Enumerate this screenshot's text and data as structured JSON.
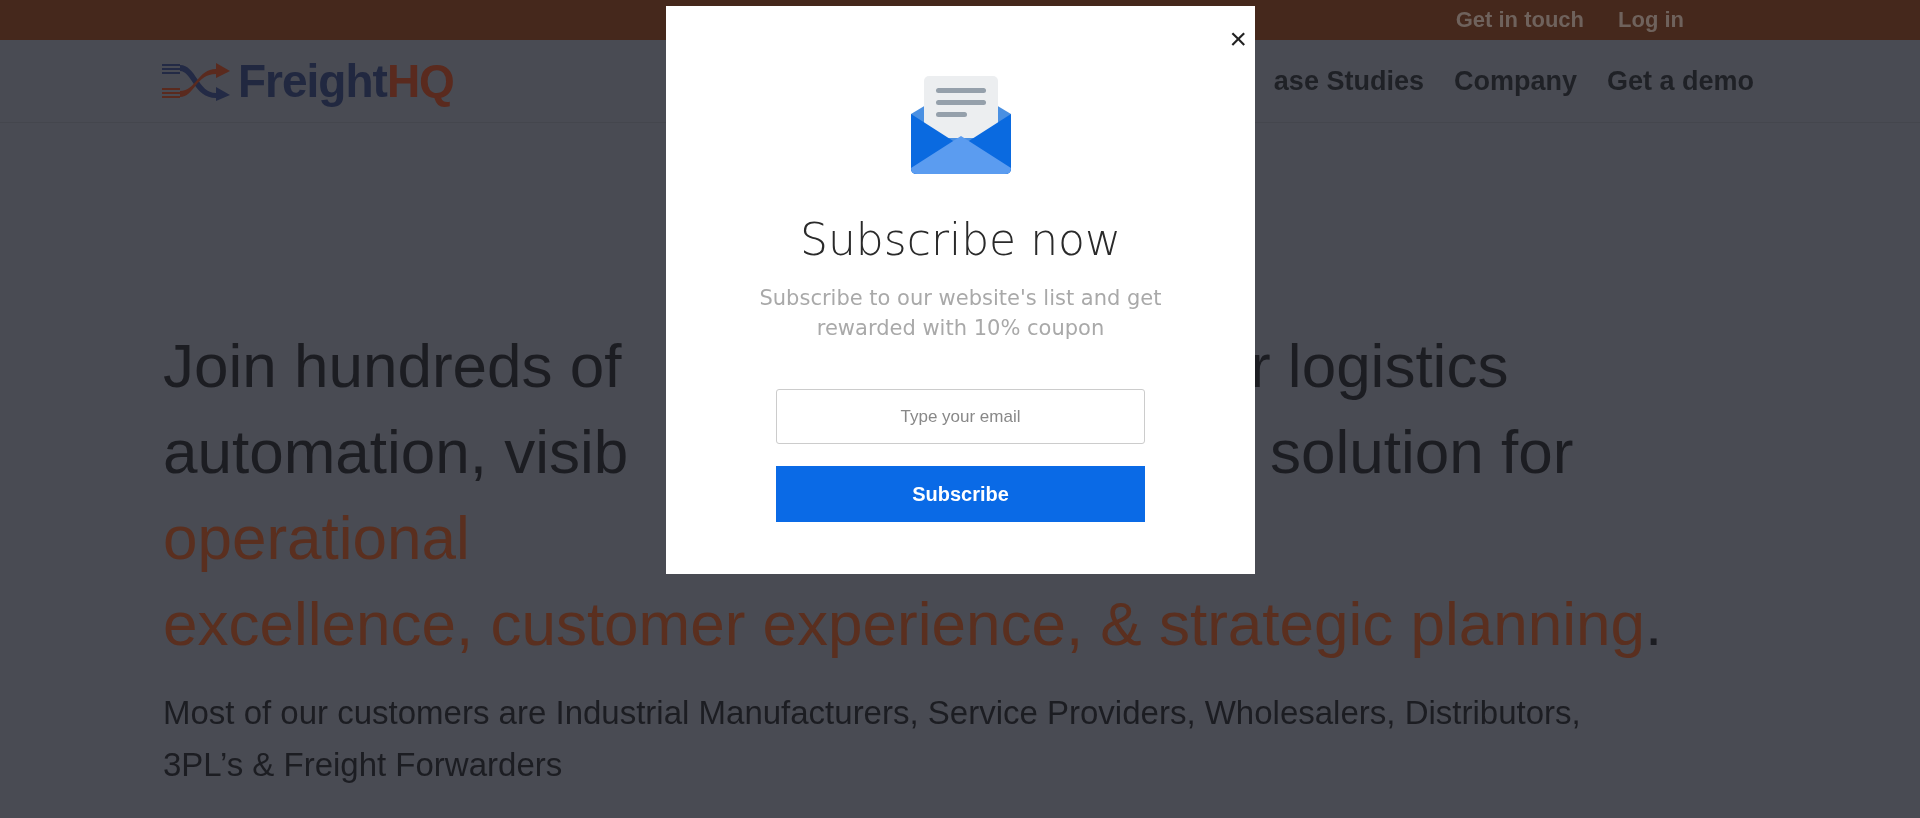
{
  "top_bar": {
    "links": [
      "Get in touch",
      "Log in"
    ]
  },
  "header": {
    "logo": {
      "first": "Freight",
      "second": "HQ"
    },
    "nav": [
      "ase Studies",
      "Company",
      "Get a demo"
    ]
  },
  "hero": {
    "lines": [
      {
        "left": "Join hundreds of",
        "right": "r logistics"
      },
      {
        "left": "automation, visib",
        "right": "solution for"
      }
    ],
    "highlight_lines": [
      "operational",
      "excellence, customer experience, & strategic planning"
    ],
    "end_mark": ".",
    "paragraph": "Most of our customers are Industrial Manufacturers, Service Providers, Wholesalers, Distributors, 3PL’s & Freight Forwarders"
  },
  "popup": {
    "close": "×",
    "title": "Subscribe now",
    "text": "Subscribe to our website's list and get rewarded with 10% coupon",
    "email": {
      "placeholder": "Type your email"
    },
    "button": "Subscribe"
  }
}
